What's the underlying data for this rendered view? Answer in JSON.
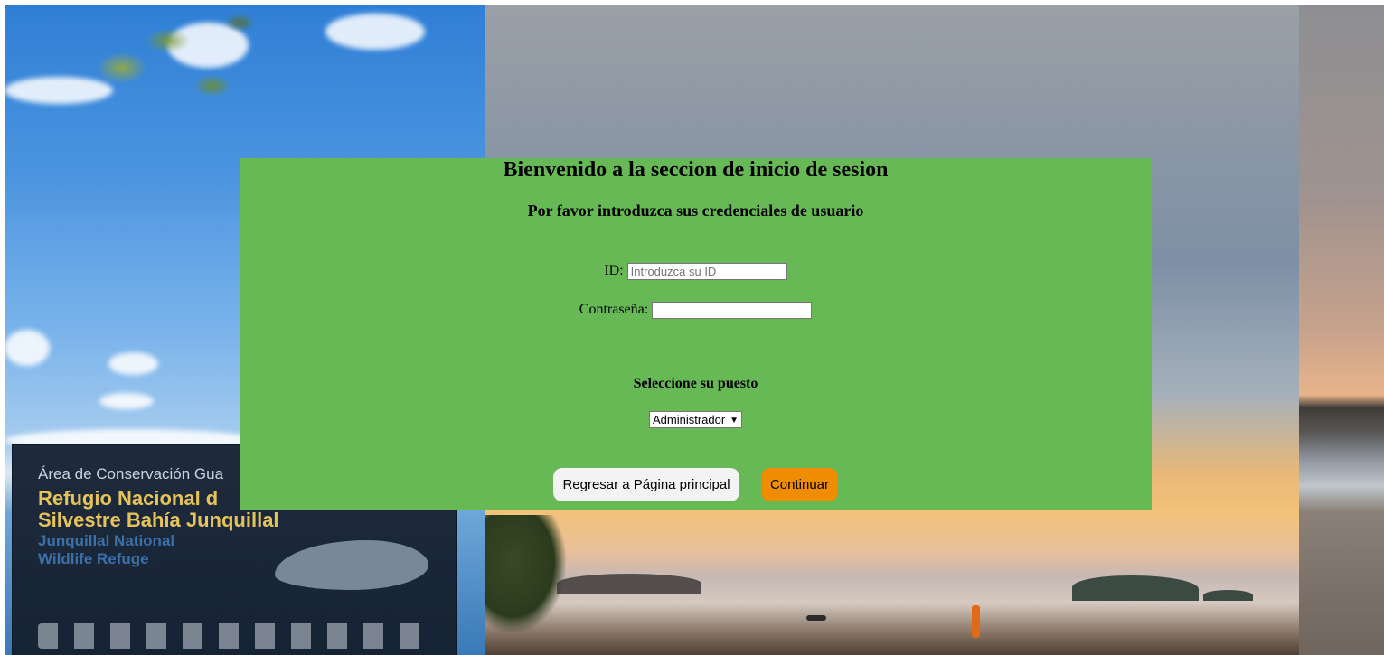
{
  "background": {
    "sign": {
      "line1": "Área de Conservación Gua",
      "line2": "Refugio Nacional d",
      "line3": "Silvestre Bahía Junquillal",
      "line4": "Junquillal National",
      "line5": "Wildlife Refuge"
    }
  },
  "login": {
    "title": "Bienvenido a la seccion de inicio de sesion",
    "subtitle": "Por favor introduzca sus credenciales de usuario",
    "id_label": "ID:",
    "id_placeholder": "Introduzca su ID",
    "id_value": "",
    "password_label": "Contraseña:",
    "password_value": "",
    "role_label": "Seleccione su puesto",
    "role_selected": "Administrador",
    "back_button": "Regresar a Página principal",
    "continue_button": "Continuar"
  },
  "colors": {
    "panel_green": "#66b954",
    "continue_orange": "#f08c00",
    "back_button_bg": "#f3f3f3"
  }
}
